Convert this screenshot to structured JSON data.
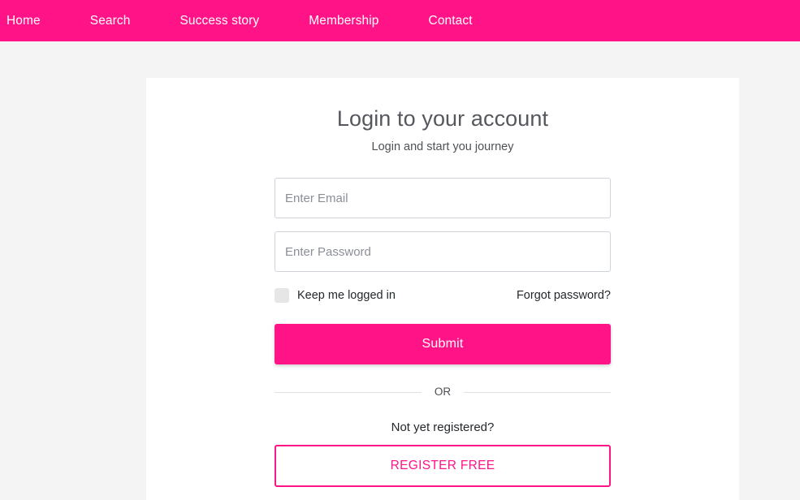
{
  "theme": {
    "accent": "#ff1387",
    "page_background": "#f4f4f4",
    "card_background": "#ffffff",
    "input_border": "#ced4da",
    "checkbox_fill": "#e6e6e6",
    "divider": "#e0e0e0",
    "heading_color": "#55585c",
    "body_text": "#24282c"
  },
  "navbar": {
    "items": [
      {
        "label": "Home",
        "name": "nav-item-home"
      },
      {
        "label": "Search",
        "name": "nav-item-search"
      },
      {
        "label": "Success story",
        "name": "nav-item-success-story"
      },
      {
        "label": "Membership",
        "name": "nav-item-membership"
      },
      {
        "label": "Contact",
        "name": "nav-item-contact"
      }
    ]
  },
  "card": {
    "title": "Login to your account",
    "subtitle": "Login and start you journey",
    "form": {
      "email": {
        "placeholder": "Enter Email",
        "value": ""
      },
      "password": {
        "placeholder": "Enter Password",
        "value": ""
      },
      "keep_logged_in": {
        "label": "Keep me logged in",
        "checked": false
      },
      "forgot_password_label": "Forgot password?",
      "submit_label": "Submit"
    },
    "divider_label": "OR",
    "not_registered_label": "Not yet registered?",
    "register_label": "REGISTER FREE"
  }
}
